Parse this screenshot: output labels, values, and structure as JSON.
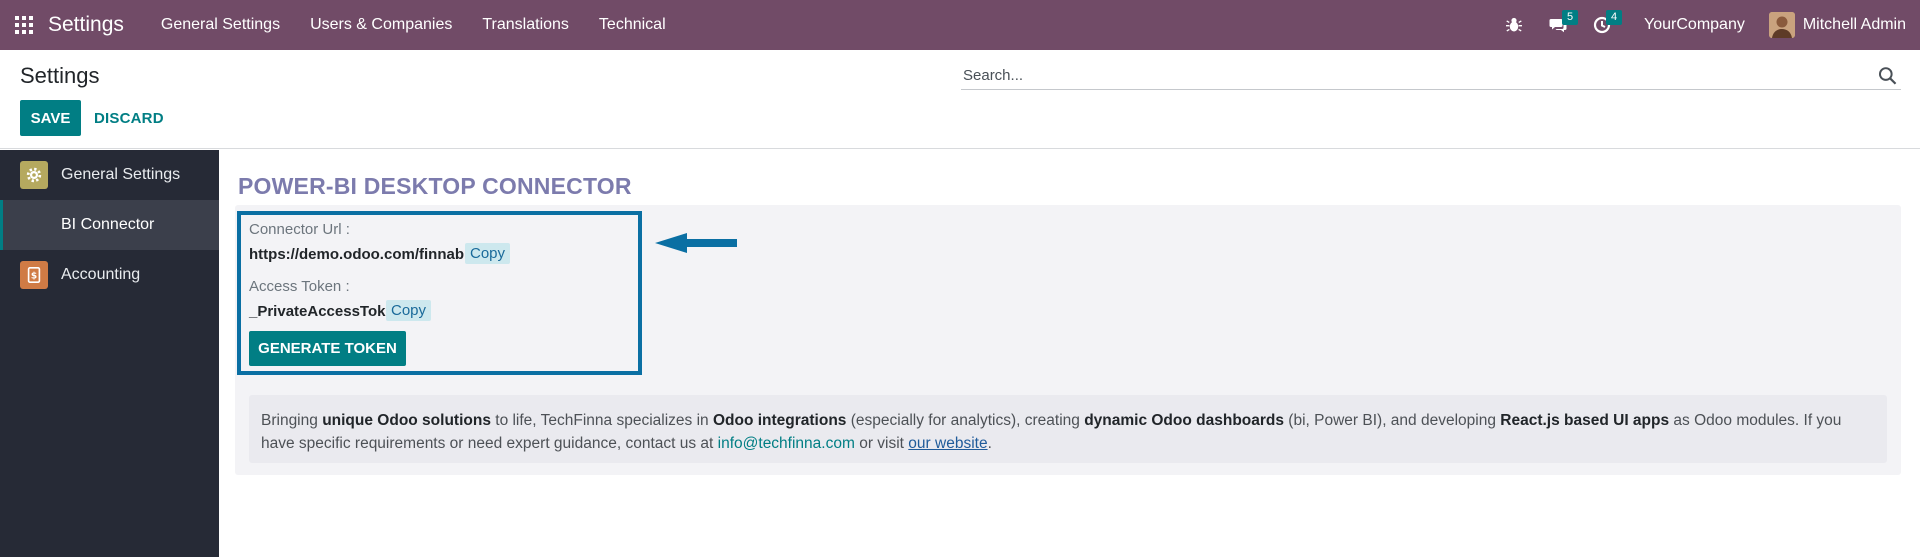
{
  "navbar": {
    "app_title": "Settings",
    "menu": [
      "General Settings",
      "Users & Companies",
      "Translations",
      "Technical"
    ],
    "messages_count": "5",
    "activities_count": "4",
    "company": "YourCompany",
    "user": "Mitchell Admin",
    "bg_color": "#714B67"
  },
  "control": {
    "title": "Settings",
    "save_label": "SAVE",
    "discard_label": "DISCARD",
    "search_placeholder": "Search..."
  },
  "sidebar": {
    "items": [
      {
        "label": "General Settings",
        "icon": "gear-icon"
      },
      {
        "label": "BI Connector"
      },
      {
        "label": "Accounting",
        "icon": "accounting-icon"
      }
    ]
  },
  "main": {
    "section_title": "POWER-BI DESKTOP CONNECTOR",
    "connector_url_label": "Connector Url :",
    "connector_url_value": "https://demo.odoo.com/finnabi/",
    "access_token_label": "Access Token :",
    "access_token_value": "_PrivateAccessToken",
    "copy_label": "Copy",
    "generate_label": "GENERATE TOKEN",
    "info": {
      "t1": "Bringing ",
      "b1": "unique Odoo solutions",
      "t2": " to life, TechFinna specializes in ",
      "b2": "Odoo integrations",
      "t3": " (especially for analytics), creating ",
      "b3": "dynamic Odoo dashboards",
      "t4": " (bi, Power BI), and developing ",
      "b4": "React.js based UI apps",
      "t5": " as Odoo modules. If you have specific requirements or need expert guidance, contact us at ",
      "email": "info@techfinna.com",
      "t6": " or visit ",
      "site": "our website",
      "t7": "."
    }
  },
  "colors": {
    "accent": "#017e84",
    "highlight_border": "#0a6fa3",
    "section_title": "#7c7bad"
  }
}
